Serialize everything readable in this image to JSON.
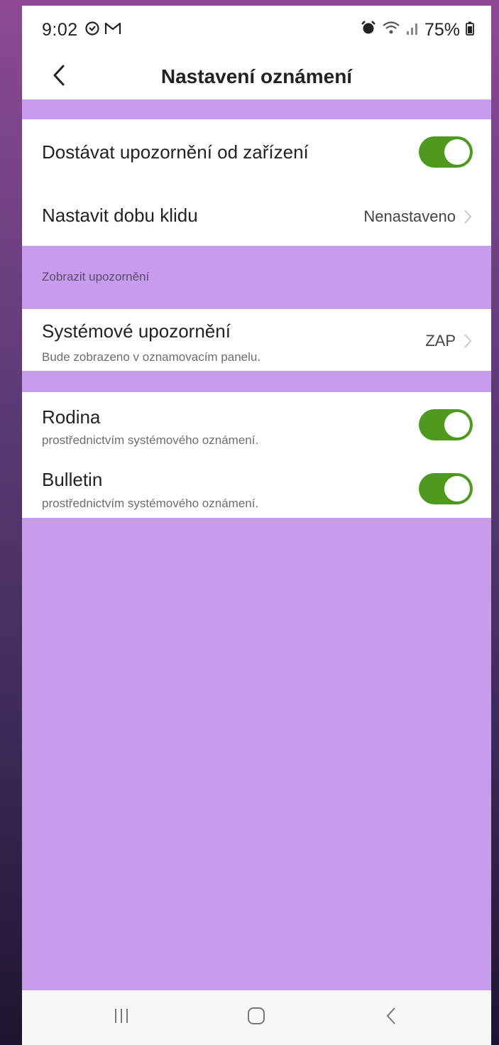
{
  "status_bar": {
    "time": "9:02",
    "left_icons": [
      "sync-icon",
      "gmail-icon"
    ],
    "right_icons": [
      "alarm-icon",
      "wifi-icon",
      "signal-icon",
      "battery-icon"
    ],
    "battery": "75%"
  },
  "header": {
    "title": "Nastavení oznámení",
    "back_icon": "back-chevron-icon"
  },
  "device_notifications": {
    "label": "Dostávat upozornění od zařízení",
    "enabled": true
  },
  "quiet_time": {
    "label": "Nastavit dobu klidu",
    "value": "Nenastaveno"
  },
  "section": {
    "label": "Zobrazit upozornění"
  },
  "system_notification": {
    "label": "Systémové upozornění",
    "description": "Bude zobrazeno v oznamovacím panelu.",
    "value": "ZAP"
  },
  "channels": [
    {
      "label": "Rodina",
      "description": "prostřednictvím systémového oznámení.",
      "enabled": true
    },
    {
      "label": "Bulletin",
      "description": "prostřednictvím systémového oznámení.",
      "enabled": true
    }
  ],
  "colors": {
    "accent": "#4e9a1e",
    "overlay": "#c89ced",
    "card": "#ffffff"
  },
  "nav_bar": {
    "buttons": [
      "recents-icon",
      "home-icon",
      "back-icon"
    ]
  }
}
